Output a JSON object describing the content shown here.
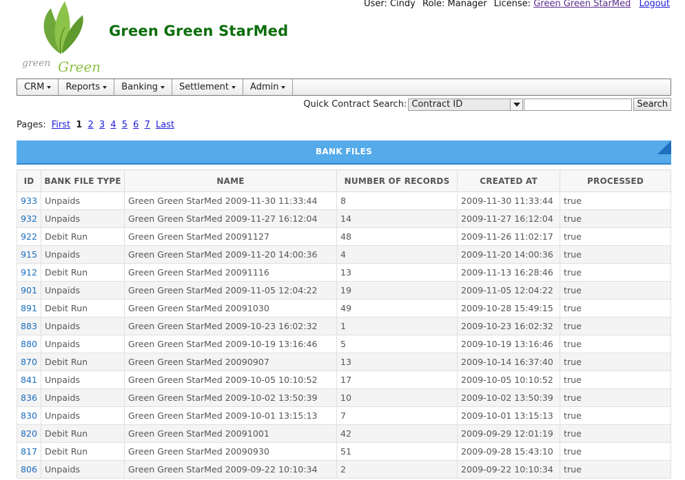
{
  "header": {
    "brand": "Green Green StarMed",
    "logo_text": "greenGreen",
    "user_label": "User:",
    "user": "Cindy",
    "role_label": "Role:",
    "role": "Manager",
    "license_label": "License:",
    "license": "Green Green StarMed",
    "logout": "Logout"
  },
  "menu": [
    "CRM",
    "Reports",
    "Banking",
    "Settlement",
    "Admin"
  ],
  "quick_search": {
    "label": "Quick Contract Search:",
    "selected": "Contract ID",
    "value": "",
    "button": "Search"
  },
  "pagination": {
    "label": "Pages:",
    "first": "First",
    "current": "1",
    "pages": [
      "2",
      "3",
      "4",
      "5",
      "6",
      "7"
    ],
    "last": "Last"
  },
  "table": {
    "title": "BANK FILES",
    "columns": [
      "ID",
      "BANK FILE TYPE",
      "NAME",
      "NUMBER OF RECORDS",
      "CREATED AT",
      "PROCESSED"
    ],
    "rows": [
      [
        "933",
        "Unpaids",
        "Green Green StarMed 2009-11-30 11:33:44",
        "8",
        "2009-11-30 11:33:44",
        "true"
      ],
      [
        "932",
        "Unpaids",
        "Green Green StarMed 2009-11-27 16:12:04",
        "14",
        "2009-11-27 16:12:04",
        "true"
      ],
      [
        "922",
        "Debit Run",
        "Green Green StarMed 20091127",
        "48",
        "2009-11-26 11:02:17",
        "true"
      ],
      [
        "915",
        "Unpaids",
        "Green Green StarMed 2009-11-20 14:00:36",
        "4",
        "2009-11-20 14:00:36",
        "true"
      ],
      [
        "912",
        "Debit Run",
        "Green Green StarMed 20091116",
        "13",
        "2009-11-13 16:28:46",
        "true"
      ],
      [
        "901",
        "Unpaids",
        "Green Green StarMed 2009-11-05 12:04:22",
        "19",
        "2009-11-05 12:04:22",
        "true"
      ],
      [
        "891",
        "Debit Run",
        "Green Green StarMed 20091030",
        "49",
        "2009-10-28 15:49:15",
        "true"
      ],
      [
        "883",
        "Unpaids",
        "Green Green StarMed 2009-10-23 16:02:32",
        "1",
        "2009-10-23 16:02:32",
        "true"
      ],
      [
        "880",
        "Unpaids",
        "Green Green StarMed 2009-10-19 13:16:46",
        "5",
        "2009-10-19 13:16:46",
        "true"
      ],
      [
        "870",
        "Debit Run",
        "Green Green StarMed 20090907",
        "13",
        "2009-10-14 16:37:40",
        "true"
      ],
      [
        "841",
        "Unpaids",
        "Green Green StarMed 2009-10-05 10:10:52",
        "17",
        "2009-10-05 10:10:52",
        "true"
      ],
      [
        "836",
        "Unpaids",
        "Green Green StarMed 2009-10-02 13:50:39",
        "10",
        "2009-10-02 13:50:39",
        "true"
      ],
      [
        "830",
        "Unpaids",
        "Green Green StarMed 2009-10-01 13:15:13",
        "7",
        "2009-10-01 13:15:13",
        "true"
      ],
      [
        "820",
        "Debit Run",
        "Green Green StarMed 20091001",
        "42",
        "2009-09-29 12:01:19",
        "true"
      ],
      [
        "817",
        "Debit Run",
        "Green Green StarMed 20090930",
        "51",
        "2009-09-28 15:43:10",
        "true"
      ],
      [
        "806",
        "Unpaids",
        "Green Green StarMed 2009-09-22 10:10:34",
        "2",
        "2009-09-22 10:10:34",
        "true"
      ]
    ]
  }
}
